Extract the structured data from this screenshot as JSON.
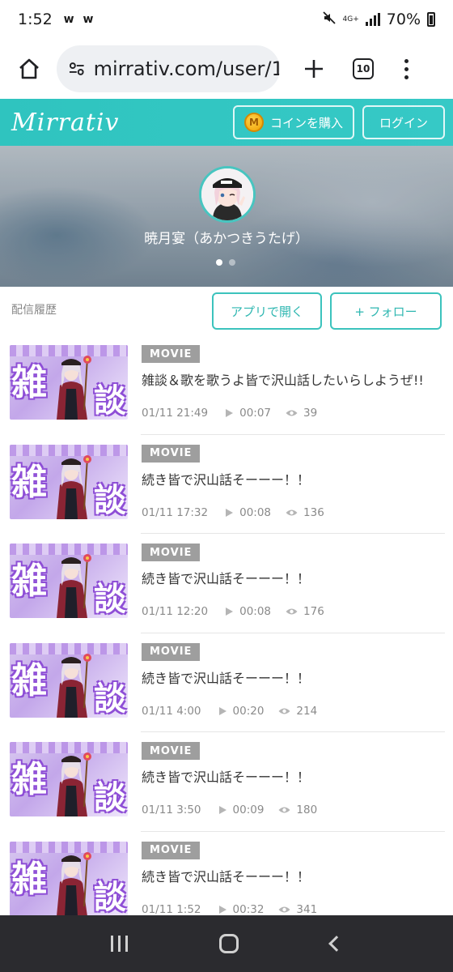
{
  "status_bar": {
    "time": "1:52",
    "notifications": "w w",
    "network": "4G+",
    "battery": "70%"
  },
  "browser": {
    "url": "mirrativ.com/user/1",
    "tab_count": "10"
  },
  "header": {
    "logo": "Mirrativ",
    "coin_button": "コインを購入",
    "coin_symbol": "M",
    "login_button": "ログイン",
    "accent_color": "#36c9c6"
  },
  "profile": {
    "name": "暁月宴（あかつきうたげ）",
    "carousel_dots": 2,
    "active_dot": 0
  },
  "actions": {
    "section_title": "配信履歴",
    "open_app": "アプリで開く",
    "follow": "+ フォロー"
  },
  "history": {
    "items": [
      {
        "badge": "MOVIE",
        "title": "雑談＆歌を歌うよ皆で沢山話したいらしようぜ!!",
        "date": "01/11 21:49",
        "duration": "00:07",
        "views": "39"
      },
      {
        "badge": "MOVIE",
        "title": "続き皆で沢山話そーーー！！",
        "date": "01/11 17:32",
        "duration": "00:08",
        "views": "136"
      },
      {
        "badge": "MOVIE",
        "title": "続き皆で沢山話そーーー！！",
        "date": "01/11 12:20",
        "duration": "00:08",
        "views": "176"
      },
      {
        "badge": "MOVIE",
        "title": "続き皆で沢山話そーーー！！",
        "date": "01/11 4:00",
        "duration": "00:20",
        "views": "214"
      },
      {
        "badge": "MOVIE",
        "title": "続き皆で沢山話そーーー！！",
        "date": "01/11 3:50",
        "duration": "00:09",
        "views": "180"
      },
      {
        "badge": "MOVIE",
        "title": "続き皆で沢山話そーーー！！",
        "date": "01/11 1:52",
        "duration": "00:32",
        "views": "341"
      }
    ]
  }
}
